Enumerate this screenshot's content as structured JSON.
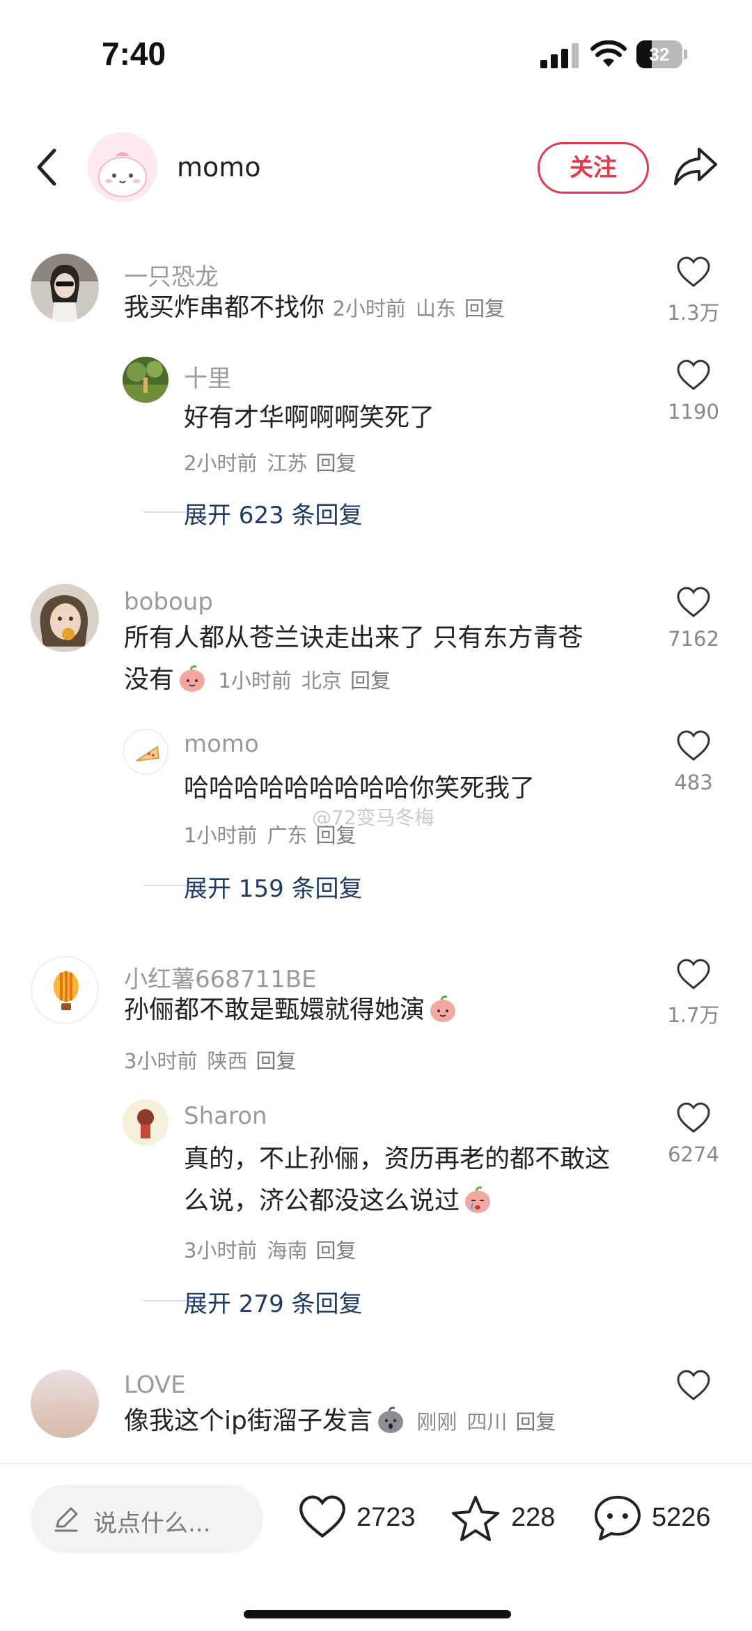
{
  "status_bar": {
    "time": "7:40",
    "battery": "32"
  },
  "header": {
    "author_name": "momo",
    "follow_label": "关注"
  },
  "comments": [
    {
      "user": "一只恐龙",
      "text": "我买炸串都不找你",
      "time": "2小时前",
      "location": "山东",
      "reply_label": "回复",
      "likes": "1.3万",
      "reply": {
        "user": "十里",
        "text": "好有才华啊啊啊笑死了",
        "time": "2小时前",
        "location": "江苏",
        "reply_label": "回复",
        "likes": "1190"
      },
      "expand_label": "展开 623 条回复"
    },
    {
      "user": "boboup",
      "text_line1": "所有人都从苍兰诀走出来了 只有东方青苍",
      "text_line2": "没有",
      "time": "1小时前",
      "location": "北京",
      "reply_label": "回复",
      "likes": "7162",
      "reply": {
        "user": "momo",
        "text": "哈哈哈哈哈哈哈哈哈你笑死我了",
        "time": "1小时前",
        "location": "广东",
        "reply_label": "回复",
        "likes": "483"
      },
      "expand_label": "展开 159 条回复"
    },
    {
      "user": "小红薯668711BE",
      "text": "孙俪都不敢是甄嬛就得她演",
      "time": "3小时前",
      "location": "陕西",
      "reply_label": "回复",
      "likes": "1.7万",
      "reply": {
        "user": "Sharon",
        "text_line1": "真的，不止孙俪，资历再老的都不敢这",
        "text_line2": "么说，济公都没这么说过",
        "time": "3小时前",
        "location": "海南",
        "reply_label": "回复",
        "likes": "6274"
      },
      "expand_label": "展开 279 条回复"
    },
    {
      "user": "LOVE",
      "text": "像我这个ip街溜子发言",
      "time": "刚刚",
      "location": "四川",
      "reply_label": "回复",
      "likes": ""
    }
  ],
  "watermark": "@72变马冬梅",
  "bottom_bar": {
    "input_placeholder": "说点什么...",
    "like_count": "2723",
    "star_count": "228",
    "comment_count": "5226"
  },
  "icons": {
    "like": "heart-icon",
    "star": "star-icon",
    "comment": "comment-bubble-icon",
    "share": "share-arrow-icon",
    "back": "chevron-left-icon",
    "edit": "pencil-icon"
  },
  "colors": {
    "accent": "#e03a4e",
    "expand_link": "#1f3b64"
  }
}
